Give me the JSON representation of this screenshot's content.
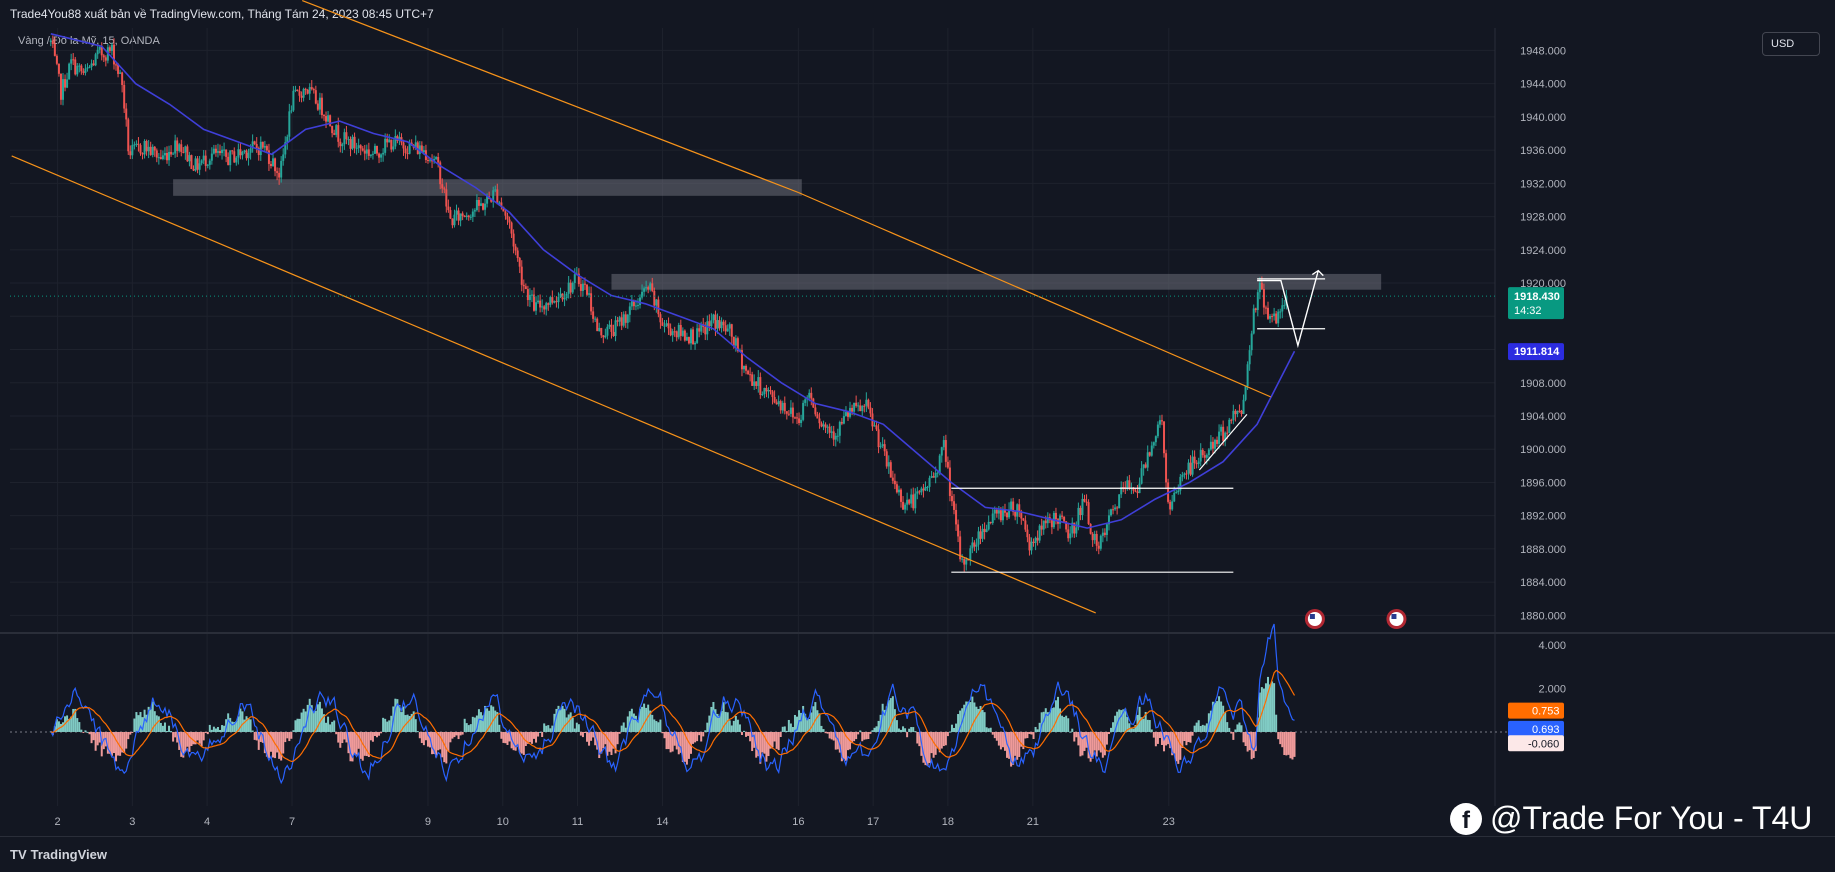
{
  "header": {
    "publish_line": "Trade4You88 xuất bản về TradingView.com, Tháng Tám 24, 2023 08:45 UTC+7",
    "symbol_line": "Vàng / Đô la Mỹ, 15, OANDA",
    "currency_button": "USD"
  },
  "footer": {
    "logo_text": "TradingView",
    "watermark": "@Trade For You - T4U"
  },
  "colors": {
    "background": "#131722",
    "up_candle": "#26a69a",
    "down_candle": "#ef5350",
    "ma_line": "#3f3fd8",
    "channel": "#f7931a",
    "zone": "#6b6e78",
    "price_label": "#089981",
    "ma_label": "#2c2ce0",
    "macd_line": "#2962ff",
    "signal_line": "#ff6d00"
  },
  "chart_data": [
    {
      "type": "candlestick",
      "title": "Vàng / Đô la Mỹ, 15, OANDA",
      "currency": "USD",
      "y_ticks": [
        1948,
        1944,
        1940,
        1936,
        1932,
        1928,
        1924,
        1920,
        1916,
        1912,
        1908,
        1904,
        1900,
        1896,
        1892,
        1888,
        1884,
        1880
      ],
      "y_tick_labels": [
        "1948.000",
        "1944.000",
        "1940.000",
        "1936.000",
        "1932.000",
        "1928.000",
        "1924.000",
        "1920.000",
        "",
        "",
        "1908.000",
        "1904.000",
        "1900.000",
        "1896.000",
        "1892.000",
        "1888.000",
        "1884.000",
        "1880.000"
      ],
      "ylim": [
        1878.0,
        1950.7
      ],
      "x_tick_labels": [
        "2",
        "3",
        "4",
        "7",
        "9",
        "10",
        "11",
        "14",
        "16",
        "17",
        "18",
        "21",
        "23"
      ],
      "x_tick_positions": [
        0.4,
        4.8,
        9.2,
        14.2,
        22.2,
        26.6,
        31.0,
        36.0,
        44.0,
        48.4,
        52.8,
        57.8,
        65.8
      ],
      "x_range": [
        -2.4,
        85.0
      ],
      "price_path": [
        [
          0.0,
          1949.0
        ],
        [
          0.6,
          1943.0
        ],
        [
          1.2,
          1946.5
        ],
        [
          2.0,
          1945.0
        ],
        [
          2.8,
          1947.5
        ],
        [
          3.6,
          1948.0
        ],
        [
          4.2,
          1944.0
        ],
        [
          4.6,
          1935.5
        ],
        [
          5.5,
          1936.5
        ],
        [
          6.5,
          1935.0
        ],
        [
          7.5,
          1937.0
        ],
        [
          8.5,
          1934.0
        ],
        [
          9.5,
          1935.5
        ],
        [
          10.5,
          1935.0
        ],
        [
          11.5,
          1936.0
        ],
        [
          12.5,
          1936.5
        ],
        [
          13.5,
          1933.0
        ],
        [
          14.2,
          1942.0
        ],
        [
          15.0,
          1943.5
        ],
        [
          16.0,
          1941.0
        ],
        [
          17.0,
          1937.5
        ],
        [
          18.0,
          1936.5
        ],
        [
          19.0,
          1935.5
        ],
        [
          20.0,
          1937.0
        ],
        [
          21.0,
          1936.5
        ],
        [
          22.0,
          1936.0
        ],
        [
          22.8,
          1934.0
        ],
        [
          23.5,
          1927.5
        ],
        [
          24.5,
          1928.5
        ],
        [
          25.5,
          1929.5
        ],
        [
          26.2,
          1931.0
        ],
        [
          27.0,
          1927.0
        ],
        [
          27.8,
          1920.0
        ],
        [
          28.5,
          1917.0
        ],
        [
          29.5,
          1918.0
        ],
        [
          30.5,
          1919.5
        ],
        [
          31.0,
          1920.5
        ],
        [
          31.6,
          1919.0
        ],
        [
          32.2,
          1914.0
        ],
        [
          33.2,
          1914.5
        ],
        [
          34.2,
          1917.0
        ],
        [
          35.2,
          1919.5
        ],
        [
          36.0,
          1915.0
        ],
        [
          37.0,
          1914.0
        ],
        [
          38.0,
          1913.5
        ],
        [
          39.0,
          1915.5
        ],
        [
          40.0,
          1914.0
        ],
        [
          41.0,
          1909.0
        ],
        [
          42.0,
          1907.0
        ],
        [
          43.0,
          1905.5
        ],
        [
          44.0,
          1903.5
        ],
        [
          44.6,
          1907.0
        ],
        [
          45.4,
          1903.0
        ],
        [
          46.2,
          1902.0
        ],
        [
          47.0,
          1904.5
        ],
        [
          48.0,
          1905.0
        ],
        [
          48.6,
          1902.0
        ],
        [
          49.4,
          1897.0
        ],
        [
          50.2,
          1893.5
        ],
        [
          51.0,
          1894.0
        ],
        [
          52.0,
          1897.0
        ],
        [
          52.6,
          1900.5
        ],
        [
          53.0,
          1894.0
        ],
        [
          53.6,
          1886.0
        ],
        [
          54.2,
          1888.0
        ],
        [
          55.0,
          1891.0
        ],
        [
          56.0,
          1892.5
        ],
        [
          57.0,
          1893.0
        ],
        [
          57.6,
          1888.5
        ],
        [
          58.4,
          1890.5
        ],
        [
          59.2,
          1892.0
        ],
        [
          60.0,
          1889.5
        ],
        [
          60.8,
          1894.0
        ],
        [
          61.6,
          1887.5
        ],
        [
          62.4,
          1892.0
        ],
        [
          63.2,
          1895.5
        ],
        [
          64.0,
          1895.5
        ],
        [
          64.8,
          1901.0
        ],
        [
          65.4,
          1903.5
        ],
        [
          65.8,
          1892.0
        ],
        [
          66.6,
          1897.0
        ],
        [
          67.4,
          1898.5
        ],
        [
          68.2,
          1900.0
        ],
        [
          69.0,
          1902.0
        ],
        [
          69.8,
          1904.5
        ],
        [
          70.2,
          1905.5
        ],
        [
          70.8,
          1917.0
        ],
        [
          71.2,
          1919.5
        ],
        [
          71.6,
          1916.5
        ],
        [
          72.2,
          1915.5
        ],
        [
          72.8,
          1918.4
        ]
      ],
      "moving_average": [
        [
          0.0,
          1950.0
        ],
        [
          3.0,
          1948.5
        ],
        [
          5.0,
          1944.0
        ],
        [
          7.0,
          1941.5
        ],
        [
          9.0,
          1938.5
        ],
        [
          11.0,
          1937.0
        ],
        [
          13.0,
          1935.5
        ],
        [
          15.0,
          1938.5
        ],
        [
          17.0,
          1939.5
        ],
        [
          19.0,
          1938.0
        ],
        [
          21.0,
          1937.0
        ],
        [
          23.0,
          1934.0
        ],
        [
          25.0,
          1931.5
        ],
        [
          27.0,
          1928.5
        ],
        [
          29.0,
          1924.0
        ],
        [
          31.0,
          1921.0
        ],
        [
          33.0,
          1918.5
        ],
        [
          35.0,
          1917.5
        ],
        [
          37.0,
          1916.0
        ],
        [
          39.0,
          1914.5
        ],
        [
          41.0,
          1911.0
        ],
        [
          43.0,
          1908.0
        ],
        [
          45.0,
          1905.5
        ],
        [
          47.0,
          1904.5
        ],
        [
          49.0,
          1903.0
        ],
        [
          51.0,
          1899.5
        ],
        [
          53.0,
          1896.0
        ],
        [
          55.0,
          1893.0
        ],
        [
          57.0,
          1892.5
        ],
        [
          59.0,
          1891.5
        ],
        [
          61.0,
          1890.5
        ],
        [
          63.0,
          1891.5
        ],
        [
          65.0,
          1894.0
        ],
        [
          67.0,
          1896.0
        ],
        [
          69.0,
          1898.5
        ],
        [
          71.0,
          1903.0
        ],
        [
          72.0,
          1907.0
        ],
        [
          73.2,
          1911.8
        ]
      ],
      "resistance_zones": [
        {
          "x0": 7.2,
          "x1": 44.2,
          "y_low": 1930.5,
          "y_high": 1932.5
        },
        {
          "x0": 33.0,
          "x1": 78.3,
          "y_low": 1919.2,
          "y_high": 1921.1
        }
      ],
      "channel_lines": [
        {
          "x0": 14.8,
          "y0": 1954.0,
          "x1": 44.0,
          "y1": 1930.9
        },
        {
          "x0": 44.0,
          "y0": 1930.9,
          "x1": 71.8,
          "y1": 1906.3
        },
        {
          "x0": -2.3,
          "y0": 1935.3,
          "x1": 61.5,
          "y1": 1880.3
        }
      ],
      "support_levels": [
        {
          "x0": 53.0,
          "x1": 69.6,
          "y": 1895.3
        },
        {
          "x0": 53.0,
          "x1": 69.6,
          "y": 1885.2
        }
      ],
      "range_box": {
        "x0": 71.0,
        "x1": 75.0,
        "y_top": 1920.5,
        "y_bottom": 1914.5
      },
      "projection_path": [
        [
          71.0,
          1920.3
        ],
        [
          72.4,
          1920.3
        ],
        [
          73.4,
          1912.5
        ],
        [
          74.6,
          1921.5
        ]
      ],
      "current_price": 1918.43,
      "current_price_label": "1918.430",
      "countdown_label": "14:32",
      "ma_value_label": "1911.814",
      "event_markers_x": [
        74.4,
        79.2
      ]
    },
    {
      "type": "macd",
      "y_tick_labels": [
        "4.000",
        "2.000"
      ],
      "y_ticks": [
        4.0,
        2.0
      ],
      "ylim": [
        -3.4,
        4.5
      ],
      "macd_label": "0.693",
      "signal_label": "0.753",
      "histogram_label": "-0.060",
      "macd_value": 0.693,
      "signal_value": 0.753,
      "histogram_value": -0.06
    }
  ]
}
